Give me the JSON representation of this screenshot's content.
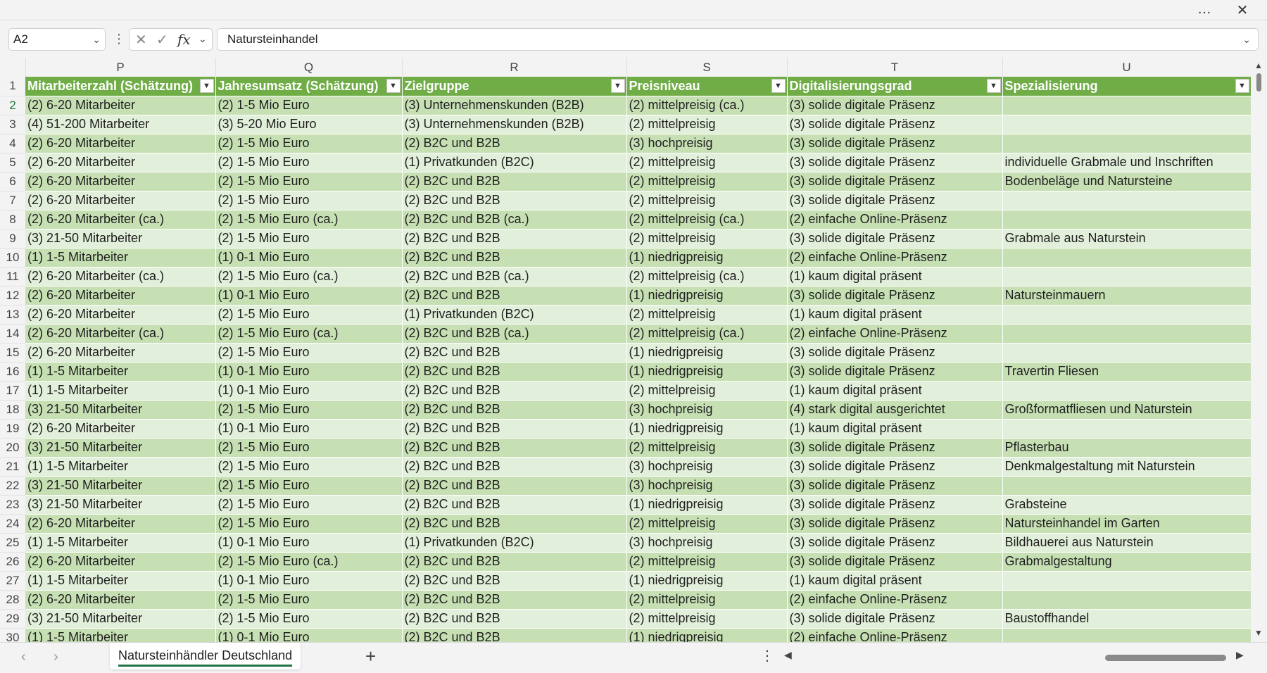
{
  "window": {
    "more_icon": "…",
    "close_icon": "✕"
  },
  "formula_bar": {
    "name_box": "A2",
    "formula": "Natursteinhandel",
    "fx": "fx"
  },
  "columns": [
    "P",
    "Q",
    "R",
    "S",
    "T",
    "U"
  ],
  "headers": [
    "Mitarbeiterzahl (Schätzung)",
    "Jahresumsatz (Schätzung)",
    "Zielgruppe",
    "Preisniveau",
    "Digitalisierungsgrad",
    "Spezialisierung"
  ],
  "row_numbers": [
    "1",
    "2",
    "3",
    "4",
    "5",
    "6",
    "7",
    "8",
    "9",
    "10",
    "11",
    "12",
    "13",
    "14",
    "15",
    "16",
    "17",
    "18",
    "19",
    "20",
    "21",
    "22",
    "23",
    "24",
    "25",
    "26",
    "27",
    "28",
    "29",
    "30"
  ],
  "rows": [
    [
      "(2) 6-20 Mitarbeiter",
      "(2) 1-5 Mio Euro",
      "(3) Unternehmenskunden (B2B)",
      "(2) mittelpreisig (ca.)",
      "(3) solide digitale Präsenz",
      ""
    ],
    [
      "(4) 51-200 Mitarbeiter",
      "(3) 5-20 Mio Euro",
      "(3) Unternehmenskunden (B2B)",
      "(2) mittelpreisig",
      "(3) solide digitale Präsenz",
      ""
    ],
    [
      "(2) 6-20 Mitarbeiter",
      "(2) 1-5 Mio Euro",
      "(2) B2C und B2B",
      "(3) hochpreisig",
      "(3) solide digitale Präsenz",
      ""
    ],
    [
      "(2) 6-20 Mitarbeiter",
      "(2) 1-5 Mio Euro",
      "(1) Privatkunden (B2C)",
      "(2) mittelpreisig",
      "(3) solide digitale Präsenz",
      "individuelle Grabmale und Inschriften"
    ],
    [
      "(2) 6-20 Mitarbeiter",
      "(2) 1-5 Mio Euro",
      "(2) B2C und B2B",
      "(2) mittelpreisig",
      "(3) solide digitale Präsenz",
      "Bodenbeläge und Natursteine"
    ],
    [
      "(2) 6-20 Mitarbeiter",
      "(2) 1-5 Mio Euro",
      "(2) B2C und B2B",
      "(2) mittelpreisig",
      "(3) solide digitale Präsenz",
      ""
    ],
    [
      "(2) 6-20 Mitarbeiter (ca.)",
      "(2) 1-5 Mio Euro (ca.)",
      "(2) B2C und B2B (ca.)",
      "(2) mittelpreisig (ca.)",
      "(2) einfache Online-Präsenz",
      ""
    ],
    [
      "(3) 21-50 Mitarbeiter",
      "(2) 1-5 Mio Euro",
      "(2) B2C und B2B",
      "(2) mittelpreisig",
      "(3) solide digitale Präsenz",
      "Grabmale aus Naturstein"
    ],
    [
      "(1) 1-5 Mitarbeiter",
      "(1) 0-1 Mio Euro",
      "(2) B2C und B2B",
      "(1) niedrigpreisig",
      "(2) einfache Online-Präsenz",
      ""
    ],
    [
      "(2) 6-20 Mitarbeiter (ca.)",
      "(2) 1-5 Mio Euro (ca.)",
      "(2) B2C und B2B (ca.)",
      "(2) mittelpreisig (ca.)",
      "(1) kaum digital präsent",
      ""
    ],
    [
      "(2) 6-20 Mitarbeiter",
      "(1) 0-1 Mio Euro",
      "(2) B2C und B2B",
      "(1) niedrigpreisig",
      "(3) solide digitale Präsenz",
      "Natursteinmauern"
    ],
    [
      "(2) 6-20 Mitarbeiter",
      "(2) 1-5 Mio Euro",
      "(1) Privatkunden (B2C)",
      "(2) mittelpreisig",
      "(1) kaum digital präsent",
      ""
    ],
    [
      "(2) 6-20 Mitarbeiter (ca.)",
      "(2) 1-5 Mio Euro (ca.)",
      "(2) B2C und B2B (ca.)",
      "(2) mittelpreisig (ca.)",
      "(2) einfache Online-Präsenz",
      ""
    ],
    [
      "(2) 6-20 Mitarbeiter",
      "(2) 1-5 Mio Euro",
      "(2) B2C und B2B",
      "(1) niedrigpreisig",
      "(3) solide digitale Präsenz",
      ""
    ],
    [
      "(1) 1-5 Mitarbeiter",
      "(1) 0-1 Mio Euro",
      "(2) B2C und B2B",
      "(1) niedrigpreisig",
      "(3) solide digitale Präsenz",
      "Travertin Fliesen"
    ],
    [
      "(1) 1-5 Mitarbeiter",
      "(1) 0-1 Mio Euro",
      "(2) B2C und B2B",
      "(2) mittelpreisig",
      "(1) kaum digital präsent",
      ""
    ],
    [
      "(3) 21-50 Mitarbeiter",
      "(2) 1-5 Mio Euro",
      "(2) B2C und B2B",
      "(3) hochpreisig",
      "(4) stark digital ausgerichtet",
      "Großformatfliesen und Naturstein"
    ],
    [
      "(2) 6-20 Mitarbeiter",
      "(1) 0-1 Mio Euro",
      "(2) B2C und B2B",
      "(1) niedrigpreisig",
      "(1) kaum digital präsent",
      ""
    ],
    [
      "(3) 21-50 Mitarbeiter",
      "(2) 1-5 Mio Euro",
      "(2) B2C und B2B",
      "(2) mittelpreisig",
      "(3) solide digitale Präsenz",
      "Pflasterbau"
    ],
    [
      "(1) 1-5 Mitarbeiter",
      "(2) 1-5 Mio Euro",
      "(2) B2C und B2B",
      "(3) hochpreisig",
      "(3) solide digitale Präsenz",
      "Denkmalgestaltung mit Naturstein"
    ],
    [
      "(3) 21-50 Mitarbeiter",
      "(2) 1-5 Mio Euro",
      "(2) B2C und B2B",
      "(3) hochpreisig",
      "(3) solide digitale Präsenz",
      ""
    ],
    [
      "(3) 21-50 Mitarbeiter",
      "(2) 1-5 Mio Euro",
      "(2) B2C und B2B",
      "(1) niedrigpreisig",
      "(3) solide digitale Präsenz",
      "Grabsteine"
    ],
    [
      "(2) 6-20 Mitarbeiter",
      "(2) 1-5 Mio Euro",
      "(2) B2C und B2B",
      "(2) mittelpreisig",
      "(3) solide digitale Präsenz",
      "Natursteinhandel im Garten"
    ],
    [
      "(1) 1-5 Mitarbeiter",
      "(1) 0-1 Mio Euro",
      "(1) Privatkunden (B2C)",
      "(3) hochpreisig",
      "(3) solide digitale Präsenz",
      "Bildhauerei aus Naturstein"
    ],
    [
      "(2) 6-20 Mitarbeiter",
      "(2) 1-5 Mio Euro (ca.)",
      "(2) B2C und B2B",
      "(2) mittelpreisig",
      "(3) solide digitale Präsenz",
      "Grabmalgestaltung"
    ],
    [
      "(1) 1-5 Mitarbeiter",
      "(1) 0-1 Mio Euro",
      "(2) B2C und B2B",
      "(1) niedrigpreisig",
      "(1) kaum digital präsent",
      ""
    ],
    [
      "(2) 6-20 Mitarbeiter",
      "(2) 1-5 Mio Euro",
      "(2) B2C und B2B",
      "(2) mittelpreisig",
      "(2) einfache Online-Präsenz",
      ""
    ],
    [
      "(3) 21-50 Mitarbeiter",
      "(2) 1-5 Mio Euro",
      "(2) B2C und B2B",
      "(2) mittelpreisig",
      "(3) solide digitale Präsenz",
      "Baustoffhandel"
    ],
    [
      "(1) 1-5 Mitarbeiter",
      "(1) 0-1 Mio Euro",
      "(2) B2C und B2B",
      "(1) niedrigpreisig",
      "(2) einfache Online-Präsenz",
      ""
    ]
  ],
  "sheet_tabs": {
    "active": "Natursteinhändler Deutschland"
  },
  "colors": {
    "header_green": "#70ad47",
    "band_dark": "#c6e0b4",
    "band_light": "#e2efda"
  }
}
